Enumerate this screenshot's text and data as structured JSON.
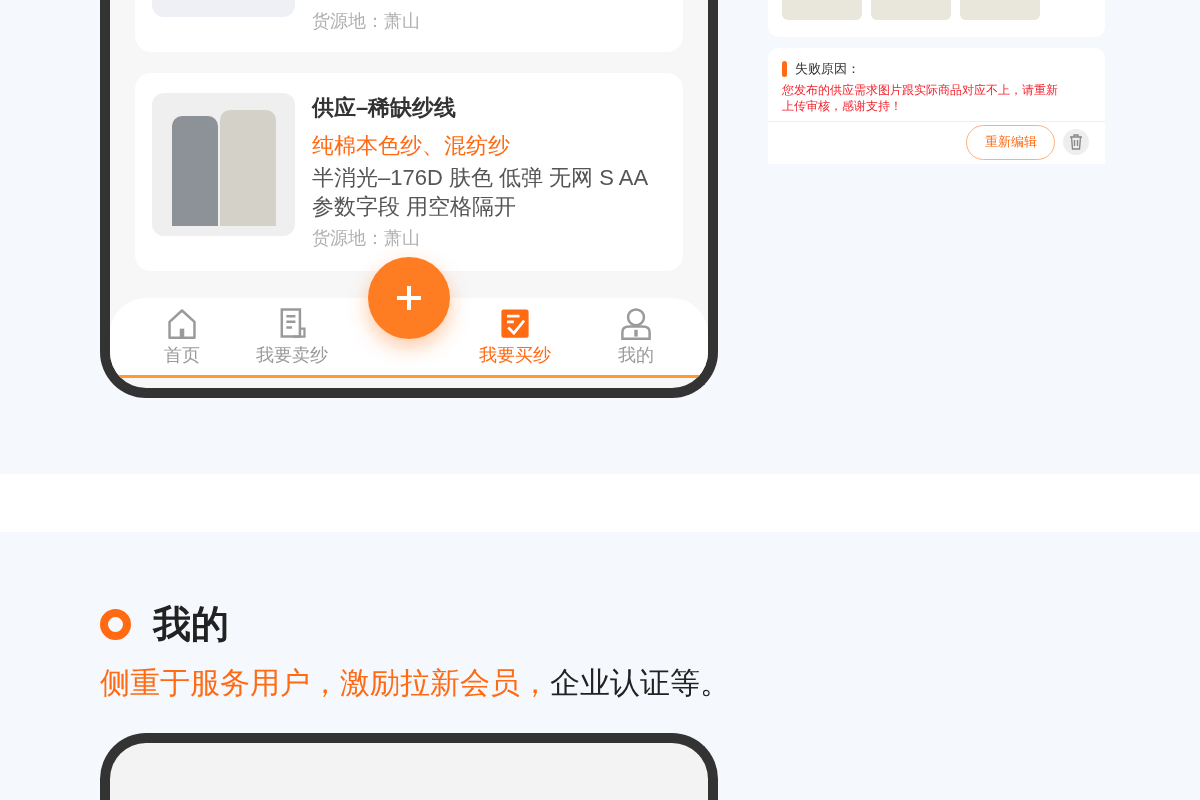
{
  "top_phone": {
    "listings": [
      {
        "origin": "货源地：萧山"
      },
      {
        "title": "供应–稀缺纱线",
        "category": "纯棉本色纱、混纺纱",
        "specs": "半消光–176D 肤色 低弹 无网 S AA 参数字段 用空格隔开",
        "origin": "货源地：萧山"
      }
    ],
    "tab_bar": {
      "items": [
        {
          "label": "首页",
          "kind": "home",
          "selected": false
        },
        {
          "label": "我要卖纱",
          "kind": "sell",
          "selected": false
        },
        {
          "label": "我要买纱",
          "kind": "buy",
          "selected": true
        },
        {
          "label": "我的",
          "kind": "me",
          "selected": false
        }
      ]
    }
  },
  "review_panel": {
    "failure": {
      "title": "失败原因：",
      "reason": "您发布的供应需求图片跟实际商品对应不上，请重新上传审核，感谢支持！",
      "edit_button": "重新编辑"
    }
  },
  "section": {
    "title": "我的",
    "highlight": "侧重于服务用户，激励拉新会员，",
    "rest": "企业认证等。"
  }
}
